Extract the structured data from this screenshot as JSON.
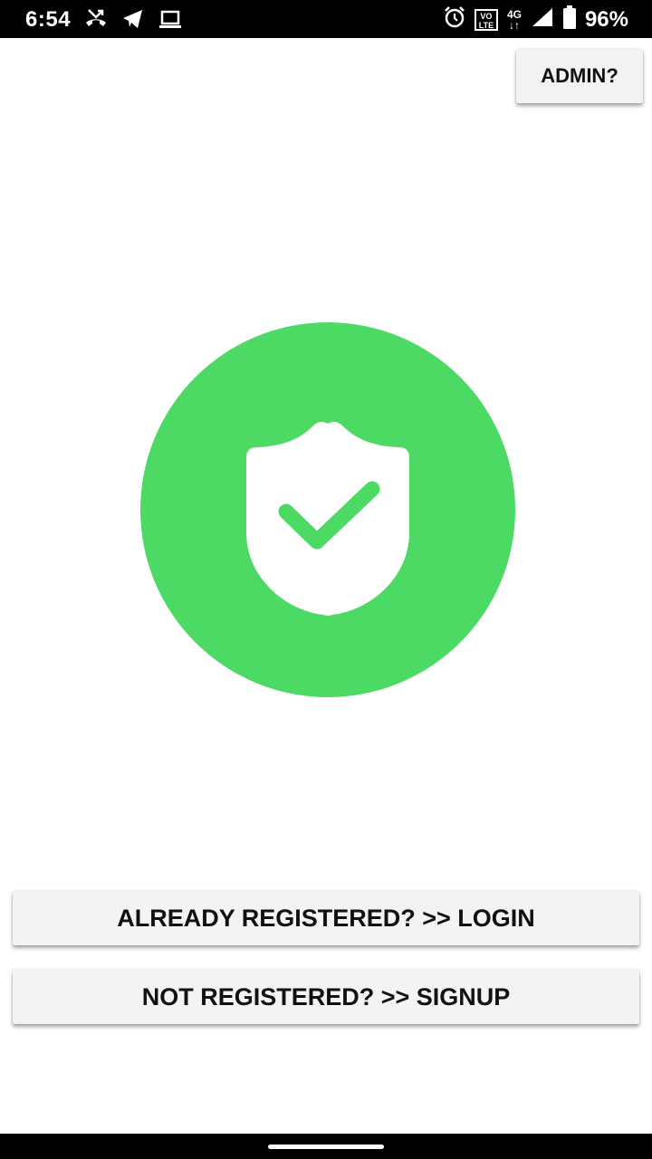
{
  "status_bar": {
    "time": "6:54",
    "left_icons": [
      "missed-call-icon",
      "telegram-icon",
      "laptop-icon"
    ],
    "right_icons": [
      "alarm-icon",
      "volte-icon",
      "network-4g-icon",
      "signal-icon",
      "battery-icon"
    ],
    "volte_label_top": "VO",
    "volte_label_bottom": "LTE",
    "network_label": "4G",
    "battery_percent": "96%"
  },
  "header": {
    "admin_label": "ADMIN?"
  },
  "logo": {
    "icon": "shield-check-icon",
    "circle_color": "#4cd964",
    "shield_color": "#ffffff"
  },
  "actions": {
    "login_label": "ALREADY REGISTERED? >> LOGIN",
    "signup_label": "NOT REGISTERED? >> SIGNUP"
  },
  "colors": {
    "accent": "#4cd964",
    "button_bg": "#f3f3f3",
    "text": "#111111"
  }
}
